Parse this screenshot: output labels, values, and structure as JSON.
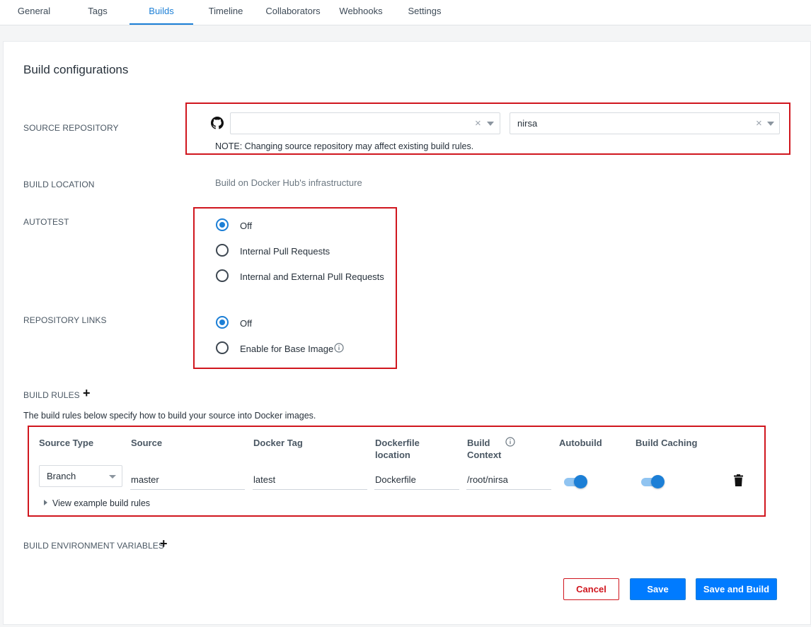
{
  "tabs": [
    {
      "label": "General"
    },
    {
      "label": "Tags"
    },
    {
      "label": "Builds"
    },
    {
      "label": "Timeline"
    },
    {
      "label": "Collaborators"
    },
    {
      "label": "Webhooks"
    },
    {
      "label": "Settings"
    }
  ],
  "active_tab": "Builds",
  "accent_color": "#1c7fd6",
  "highlight_color": "#d0161e",
  "page": {
    "title": "Build configurations"
  },
  "source_repository": {
    "label": "SOURCE REPOSITORY",
    "icon": "github-icon",
    "organization_value": "",
    "repository_value": "nirsa",
    "note": "NOTE: Changing source repository may affect existing build rules."
  },
  "build_location": {
    "label": "BUILD LOCATION",
    "value": "Build on Docker Hub's infrastructure"
  },
  "autotest": {
    "label": "AUTOTEST",
    "options": [
      {
        "label": "Off",
        "selected": true
      },
      {
        "label": "Internal Pull Requests",
        "selected": false
      },
      {
        "label": "Internal and External Pull Requests",
        "selected": false
      }
    ]
  },
  "repository_links": {
    "label": "REPOSITORY LINKS",
    "options": [
      {
        "label": "Off",
        "selected": true
      },
      {
        "label": "Enable for Base Image",
        "selected": false
      }
    ],
    "info_icon": "info-icon"
  },
  "build_rules": {
    "label": "BUILD RULES",
    "add_icon": "plus-icon",
    "description": "The build rules below specify how to build your source into Docker images.",
    "columns": {
      "source_type": "Source Type",
      "source": "Source",
      "docker_tag": "Docker Tag",
      "dockerfile_location": "Dockerfile location",
      "build_context": "Build Context",
      "autobuild": "Autobuild",
      "build_caching": "Build Caching"
    },
    "rows": [
      {
        "source_type": "Branch",
        "source": "master",
        "docker_tag": "latest",
        "dockerfile_location": "Dockerfile",
        "build_context": "/root/nirsa",
        "autobuild": true,
        "build_caching": true,
        "delete_icon": "trash-icon"
      }
    ],
    "examples_link": "View example build rules"
  },
  "build_env": {
    "label": "BUILD ENVIRONMENT VARIABLES",
    "add_icon": "plus-icon"
  },
  "actions": {
    "cancel": "Cancel",
    "save": "Save",
    "save_and_build": "Save and Build"
  }
}
